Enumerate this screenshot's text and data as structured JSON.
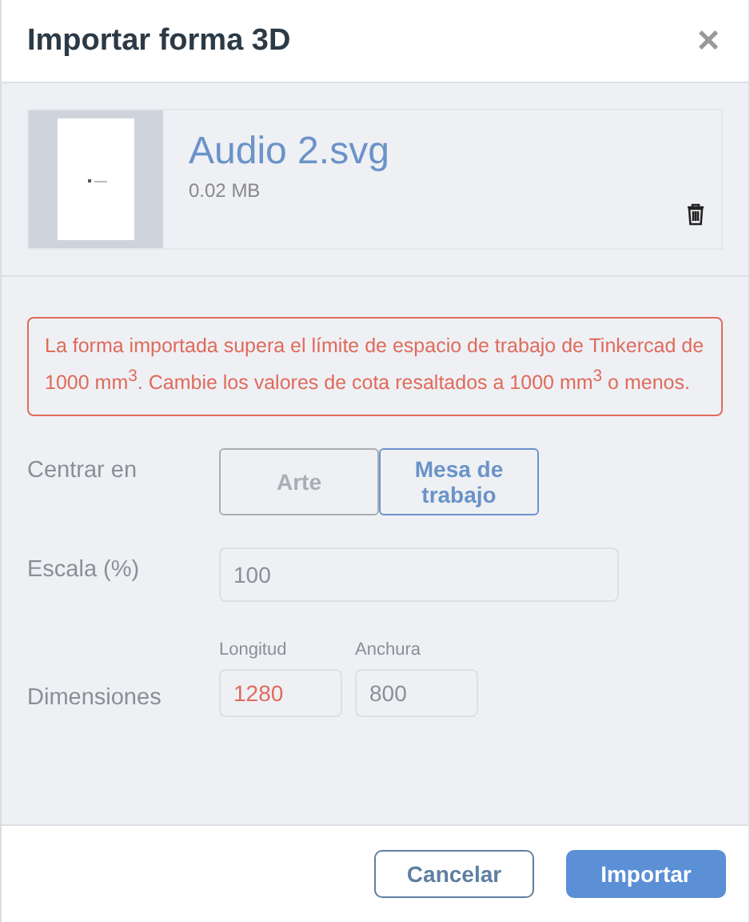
{
  "dialog": {
    "title": "Importar forma 3D",
    "close": "×"
  },
  "file": {
    "name": "Audio 2.svg",
    "size": "0.02 MB"
  },
  "error": {
    "message": "La forma importada supera el límite de espacio de trabajo de Tinkercad de 1000 mm$^{3}$. Cambie los valores de cota resaltados a 1000 mm$^{3}$ o menos."
  },
  "center": {
    "label": "Centrar en",
    "options": [
      {
        "label": "Arte",
        "selected": false
      },
      {
        "label": "Mesa de trabajo",
        "selected": true
      }
    ]
  },
  "scale": {
    "label": "Escala (%)",
    "value": "100"
  },
  "dimensions": {
    "label": "Dimensiones",
    "fields": [
      {
        "label": "Longitud",
        "value": "1280",
        "highlighted": true
      },
      {
        "label": "Anchura",
        "value": "800",
        "highlighted": false
      }
    ]
  },
  "buttons": [
    {
      "label": "Cancelar",
      "kind": "secondary"
    },
    {
      "label": "Importar",
      "kind": "primary"
    }
  ]
}
